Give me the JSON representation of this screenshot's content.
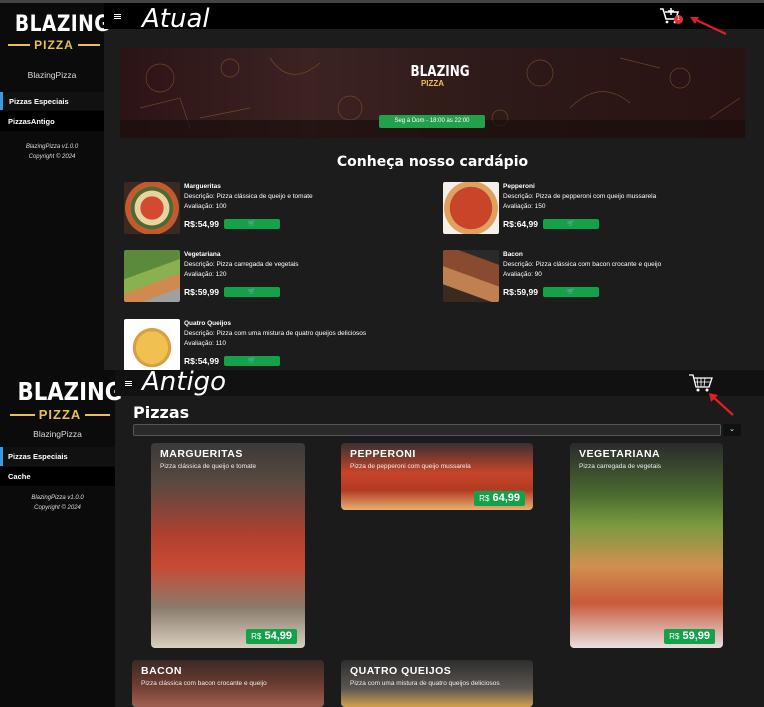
{
  "top": {
    "overlay_title": "Atual",
    "logo": {
      "word": "BLAZING",
      "sub": "PIZZA"
    },
    "app_name": "BlazingPizza",
    "nav": [
      {
        "label": "Pizzas Especiais"
      },
      {
        "label": "PizzasAntigo"
      }
    ],
    "version": "BlazingPizza v1.0.0",
    "copyright": "Copyright © 2024",
    "cart_count": "1",
    "banner": {
      "logo_word": "BLAZING",
      "logo_sub": "PIZZA",
      "hours": "Seg à Dom - 18:00 às 22:00"
    },
    "heading": "Conheça nosso cardápio",
    "add_icon": "add-to-cart-icon",
    "pizzas": [
      {
        "name": "Margueritas",
        "desc": "Descrição: Pizza clássica de queijo e tomate",
        "rating": "Avaliação: 100",
        "price": "R$:54,99"
      },
      {
        "name": "Pepperoni",
        "desc": "Descrição: Pizza de pepperoni com queijo mussarela",
        "rating": "Avaliação: 150",
        "price": "R$:64,99"
      },
      {
        "name": "Vegetariana",
        "desc": "Descrição: Pizza carregada de vegetais",
        "rating": "Avaliação: 120",
        "price": "R$:59,99"
      },
      {
        "name": "Bacon",
        "desc": "Descrição: Pizza clássica com bacon crocante e queijo",
        "rating": "Avaliação: 90",
        "price": "R$:59,99"
      },
      {
        "name": "Quatro Queijos",
        "desc": "Descrição: Pizza com uma mistura de quatro queijos deliciosos",
        "rating": "Avaliação: 110",
        "price": "R$:54,99"
      }
    ]
  },
  "bottom": {
    "overlay_title": "Antigo",
    "logo": {
      "word": "BLAZING",
      "sub": "PIZZA"
    },
    "app_name": "BlazingPizza",
    "nav": [
      {
        "label": "Pizzas Especiais"
      },
      {
        "label": "Cache"
      }
    ],
    "version": "BlazingPizza v1.0.0",
    "copyright": "Copyright © 2024",
    "page_title": "Pizzas",
    "currency": "R$",
    "cards": [
      {
        "title": "MARGUERITAS",
        "desc": "Pizza clássica de queijo e tomate",
        "price": "54,99"
      },
      {
        "title": "PEPPERONI",
        "desc": "Pizza de pepperoni com queijo mussarela",
        "price": "64,99"
      },
      {
        "title": "VEGETARIANA",
        "desc": "Pizza carregada de vegetais",
        "price": "59,99"
      },
      {
        "title": "BACON",
        "desc": "Pizza clássica com bacon crocante e queijo",
        "price": ""
      },
      {
        "title": "QUATRO QUEIJOS",
        "desc": "Pizza com uma mistura de quatro queijos deliciosos",
        "price": ""
      }
    ]
  },
  "colors": {
    "accent_green": "#13a24a",
    "nav_accent": "#3a9be0",
    "logo_gold": "#e6c050",
    "arrow_red": "#e02020"
  }
}
